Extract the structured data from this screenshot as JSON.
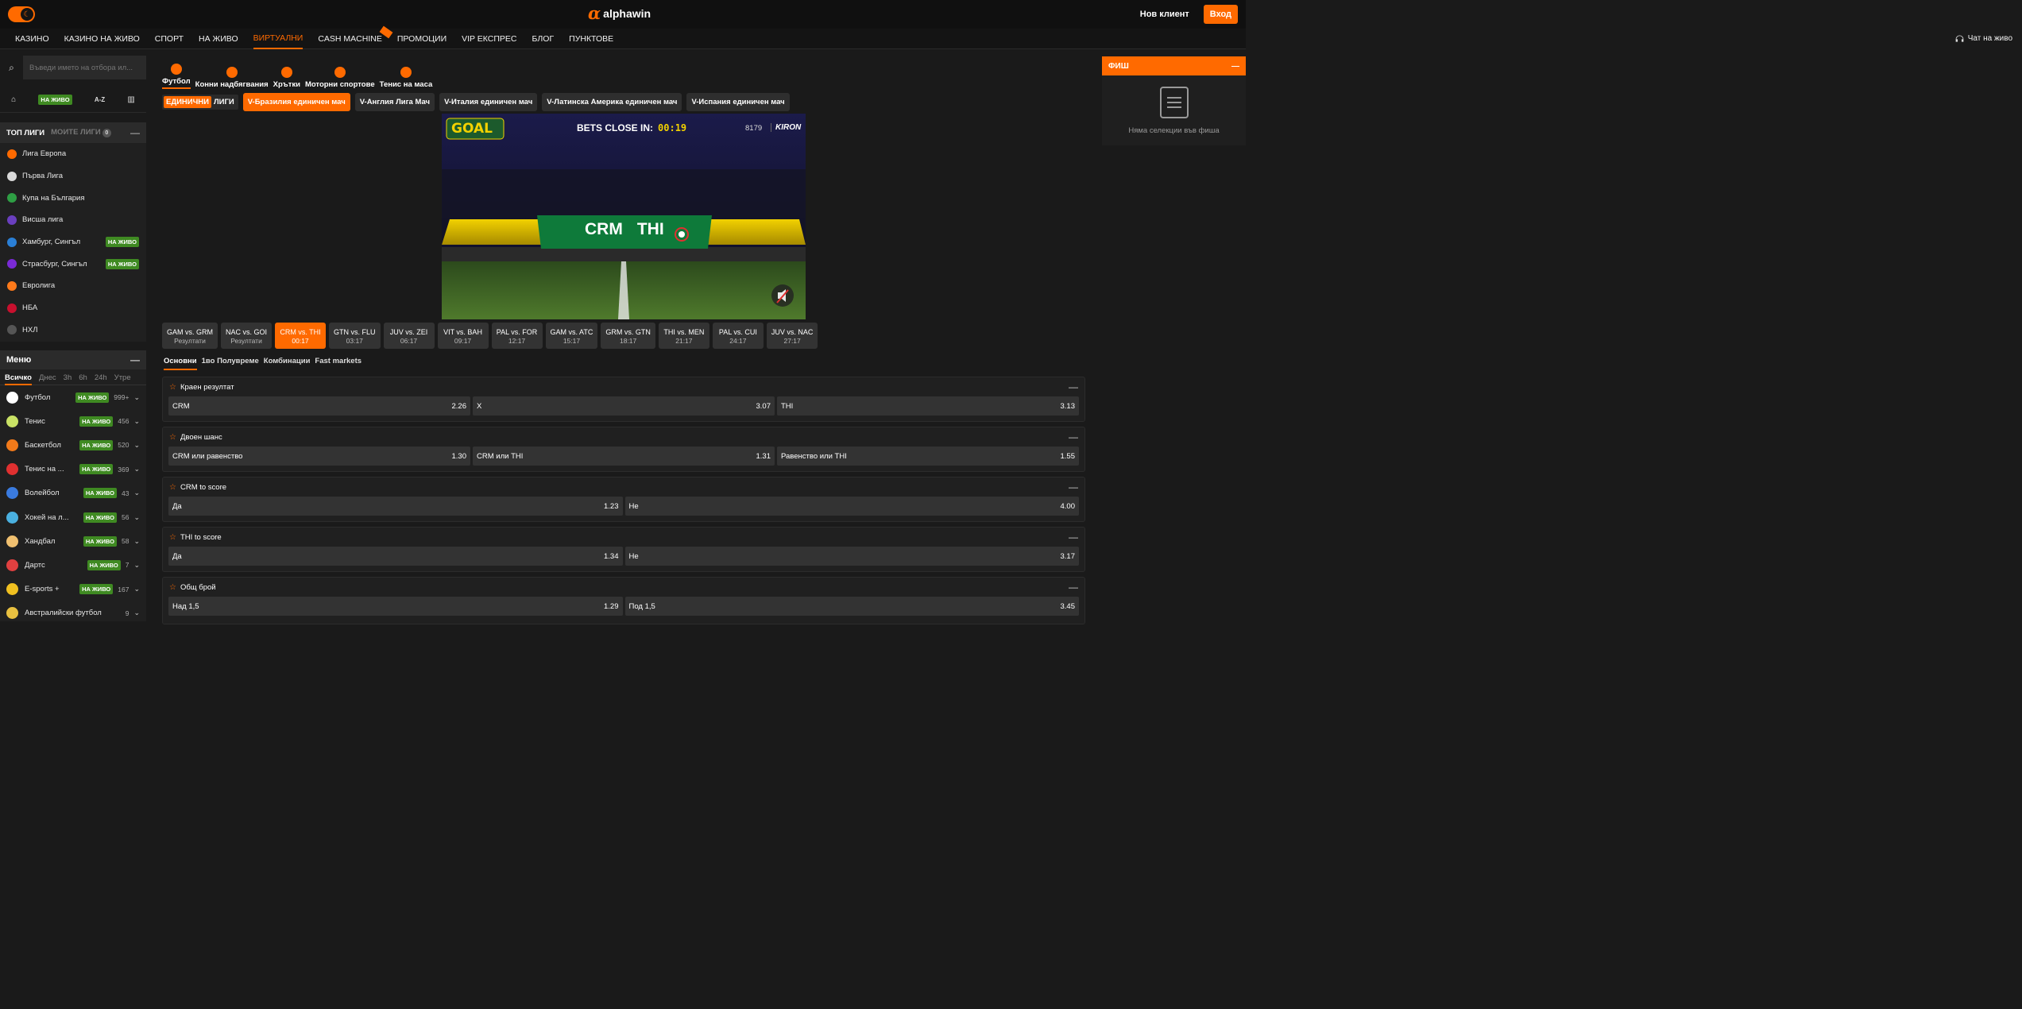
{
  "header": {
    "brand": "alphawin",
    "brand_mark": "α",
    "new_client": "Нов клиент",
    "login": "Вход"
  },
  "nav": {
    "items": [
      "Казино",
      "Казино на живо",
      "Спорт",
      "На живо",
      "Виртуални",
      "Cash Machine",
      "Промоции",
      "VIP експрес",
      "Блог",
      "Пунктове"
    ],
    "active": "Виртуални",
    "chat": "Чат на живо"
  },
  "left": {
    "search_placeholder": "Въведи името на отбора ил...",
    "quick": {
      "live": "НА ЖИВО",
      "az": "A-Z"
    },
    "top_leagues": {
      "tab_top": "ТОП ЛИГИ",
      "tab_mine": "МОИТЕ ЛИГИ",
      "mine_count": "0",
      "items": [
        {
          "name": "Лига Европа",
          "live": "",
          "color": "#ff6a00"
        },
        {
          "name": "Първа Лига",
          "live": "",
          "color": "#d9d9d9"
        },
        {
          "name": "Купа на България",
          "live": "",
          "color": "#2e9e44"
        },
        {
          "name": "Висша лига",
          "live": "",
          "color": "#6a3fbf"
        },
        {
          "name": "Хамбург, Сингъл",
          "live": "НА ЖИВО",
          "color": "#2a7fd6"
        },
        {
          "name": "Страсбург, Сингъл",
          "live": "НА ЖИВО",
          "color": "#7a2ad6"
        },
        {
          "name": "Евролига",
          "live": "",
          "color": "#ff7a1a"
        },
        {
          "name": "НБА",
          "live": "",
          "color": "#c8102e"
        },
        {
          "name": "НХЛ",
          "live": "",
          "color": "#555555"
        }
      ]
    },
    "menu": {
      "title": "Меню",
      "time_tabs": [
        "Всичко",
        "Днес",
        "3h",
        "6h",
        "24h",
        "Утре"
      ],
      "active_tab": "Всичко",
      "sports": [
        {
          "name": "Футбол",
          "live": "НА ЖИВО",
          "count": "999+",
          "color": "#ffffff"
        },
        {
          "name": "Тенис",
          "live": "НА ЖИВО",
          "count": "456",
          "color": "#c9e265"
        },
        {
          "name": "Баскетбол",
          "live": "НА ЖИВО",
          "count": "520",
          "color": "#f27a1a"
        },
        {
          "name": "Тенис на ...",
          "live": "НА ЖИВО",
          "count": "369",
          "color": "#e03030"
        },
        {
          "name": "Волейбол",
          "live": "НА ЖИВО",
          "count": "43",
          "color": "#3a7be0"
        },
        {
          "name": "Хокей на л...",
          "live": "НА ЖИВО",
          "count": "56",
          "color": "#4ab0e0"
        },
        {
          "name": "Хандбал",
          "live": "НА ЖИВО",
          "count": "58",
          "color": "#f0c070"
        },
        {
          "name": "Дартс",
          "live": "НА ЖИВО",
          "count": "7",
          "color": "#e04040"
        },
        {
          "name": "E-sports +",
          "live": "НА ЖИВО",
          "count": "167",
          "color": "#f0c020"
        },
        {
          "name": "Австралийски футбол",
          "live": "",
          "count": "9",
          "color": "#e8c040"
        }
      ]
    }
  },
  "virtual_tabs": [
    "Футбол",
    "Конни надбягвания",
    "Хрътки",
    "Моторни спортове",
    "Тенис на маса"
  ],
  "virtual_active": "Футбол",
  "mode": {
    "single": "ЕДИНИЧНИ",
    "leagues": "ЛИГИ"
  },
  "leagues": [
    "V-Бразилия единичен мач",
    "V-Англия Лига Мач",
    "V-Италия единичен мач",
    "V-Латинска Америка единичен мач",
    "V-Испания единичен мач"
  ],
  "active_league": "V-Бразилия единичен мач",
  "video": {
    "logo": "GOAL",
    "bets_close": "BETS CLOSE IN:",
    "timer": "00:19",
    "event_id": "8179",
    "provider": "KIRON",
    "home": "CRM",
    "away": "THI"
  },
  "matches": [
    {
      "teams": "GAM vs. GRM",
      "time": "Резултати"
    },
    {
      "teams": "NAC vs. GOI",
      "time": "Резултати"
    },
    {
      "teams": "CRM vs. THI",
      "time": "00:17"
    },
    {
      "teams": "GTN vs. FLU",
      "time": "03:17"
    },
    {
      "teams": "JUV vs. ZEI",
      "time": "06:17"
    },
    {
      "teams": "VIT vs. BAH",
      "time": "09:17"
    },
    {
      "teams": "PAL vs. FOR",
      "time": "12:17"
    },
    {
      "teams": "GAM vs. ATC",
      "time": "15:17"
    },
    {
      "teams": "GRM vs. GTN",
      "time": "18:17"
    },
    {
      "teams": "THI vs. MEN",
      "time": "21:17"
    },
    {
      "teams": "PAL vs. CUI",
      "time": "24:17"
    },
    {
      "teams": "JUV vs. NAC",
      "time": "27:17"
    }
  ],
  "active_match": "CRM vs. THI",
  "market_tabs": [
    "Основни",
    "1во Полувреме",
    "Комбинации",
    "Fast markets"
  ],
  "active_market_tab": "Основни",
  "markets": [
    {
      "title": "Краен резултат",
      "odds": [
        {
          "label": "CRM",
          "value": "2.26"
        },
        {
          "label": "X",
          "value": "3.07"
        },
        {
          "label": "THI",
          "value": "3.13"
        }
      ]
    },
    {
      "title": "Двоен шанс",
      "odds": [
        {
          "label": "CRM или равенство",
          "value": "1.30"
        },
        {
          "label": "CRM или THI",
          "value": "1.31"
        },
        {
          "label": "Равенство или THI",
          "value": "1.55"
        }
      ]
    },
    {
      "title": "CRM to score",
      "odds": [
        {
          "label": "Да",
          "value": "1.23"
        },
        {
          "label": "Не",
          "value": "4.00"
        }
      ]
    },
    {
      "title": "THI to score",
      "odds": [
        {
          "label": "Да",
          "value": "1.34"
        },
        {
          "label": "Не",
          "value": "3.17"
        }
      ]
    },
    {
      "title": "Общ брой",
      "odds": [
        {
          "label": "Над 1,5",
          "value": "1.29"
        },
        {
          "label": "Под 1,5",
          "value": "3.45"
        }
      ]
    }
  ],
  "betslip": {
    "title": "ФИШ",
    "empty": "Няма селекции във фиша"
  },
  "colors": {
    "accent": "#ff6a00",
    "live": "#3f8a22",
    "bg": "#1a1a1a"
  }
}
